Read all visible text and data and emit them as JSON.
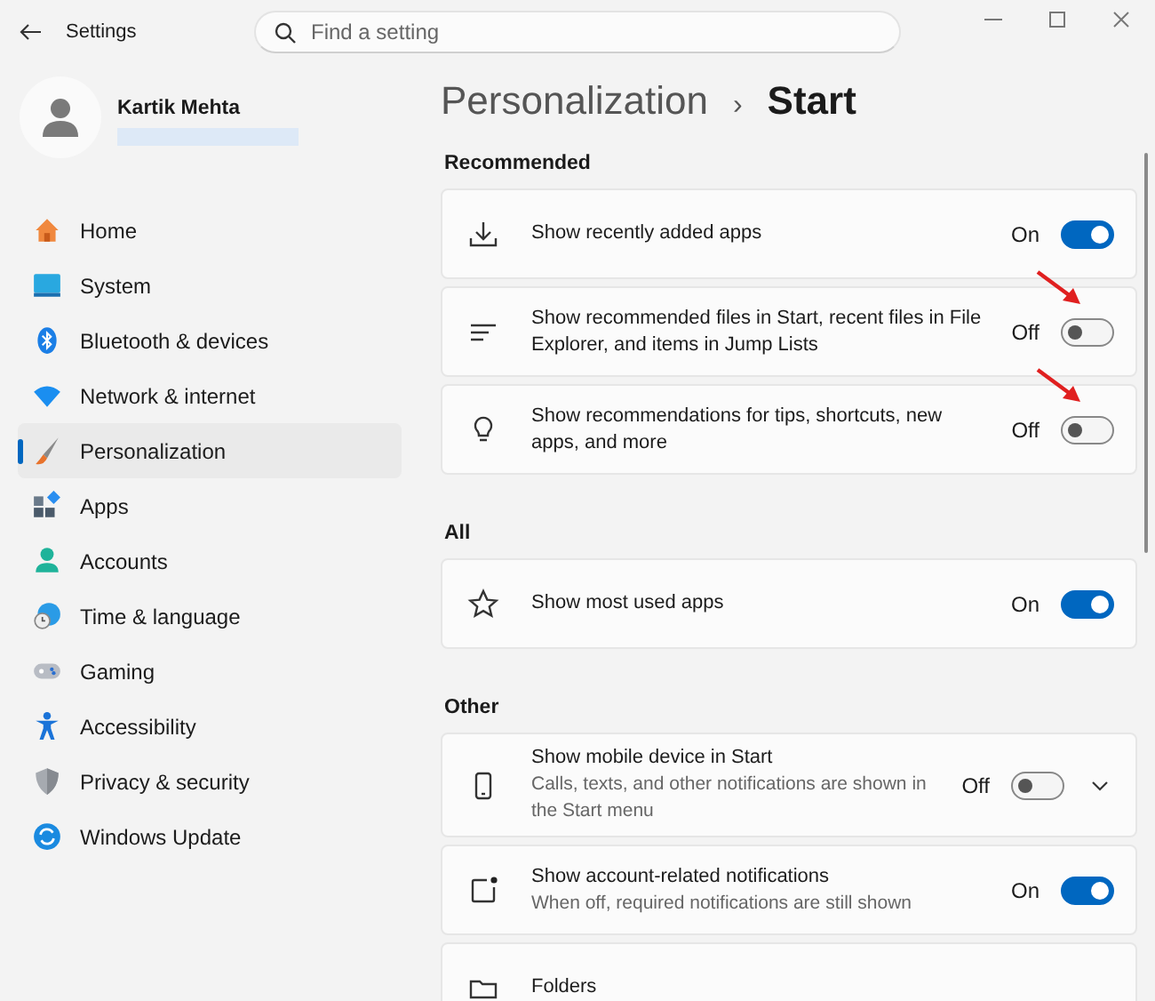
{
  "window": {
    "title": "Settings"
  },
  "search": {
    "placeholder": "Find a setting"
  },
  "user": {
    "name": "Kartik Mehta"
  },
  "nav": [
    {
      "label": "Home",
      "selected": false
    },
    {
      "label": "System",
      "selected": false
    },
    {
      "label": "Bluetooth & devices",
      "selected": false
    },
    {
      "label": "Network & internet",
      "selected": false
    },
    {
      "label": "Personalization",
      "selected": true
    },
    {
      "label": "Apps",
      "selected": false
    },
    {
      "label": "Accounts",
      "selected": false
    },
    {
      "label": "Time & language",
      "selected": false
    },
    {
      "label": "Gaming",
      "selected": false
    },
    {
      "label": "Accessibility",
      "selected": false
    },
    {
      "label": "Privacy & security",
      "selected": false
    },
    {
      "label": "Windows Update",
      "selected": false
    }
  ],
  "breadcrumb": {
    "parent": "Personalization",
    "separator": "›",
    "current": "Start"
  },
  "sections": [
    {
      "title": "Recommended",
      "rows": [
        {
          "kind": "toggle",
          "title": "Show recently added apps",
          "state_label": "On",
          "on": true,
          "annotated": false
        },
        {
          "kind": "toggle",
          "title": "Show recommended files in Start, recent files in File Explorer, and items in Jump Lists",
          "state_label": "Off",
          "on": false,
          "annotated": true
        },
        {
          "kind": "toggle",
          "title": "Show recommendations for tips, shortcuts, new apps, and more",
          "state_label": "Off",
          "on": false,
          "annotated": true
        }
      ]
    },
    {
      "title": "All",
      "rows": [
        {
          "kind": "toggle",
          "title": "Show most used apps",
          "state_label": "On",
          "on": true,
          "annotated": false
        }
      ]
    },
    {
      "title": "Other",
      "rows": [
        {
          "kind": "expander",
          "title": "Show mobile device in Start",
          "subtitle": "Calls, texts, and other notifications are shown in the Start menu",
          "state_label": "Off",
          "on": false,
          "annotated": false
        },
        {
          "kind": "toggle",
          "title": "Show account-related notifications",
          "subtitle": "When off, required notifications are still shown",
          "state_label": "On",
          "on": true,
          "annotated": false
        },
        {
          "kind": "link",
          "title": "Folders"
        }
      ]
    }
  ]
}
